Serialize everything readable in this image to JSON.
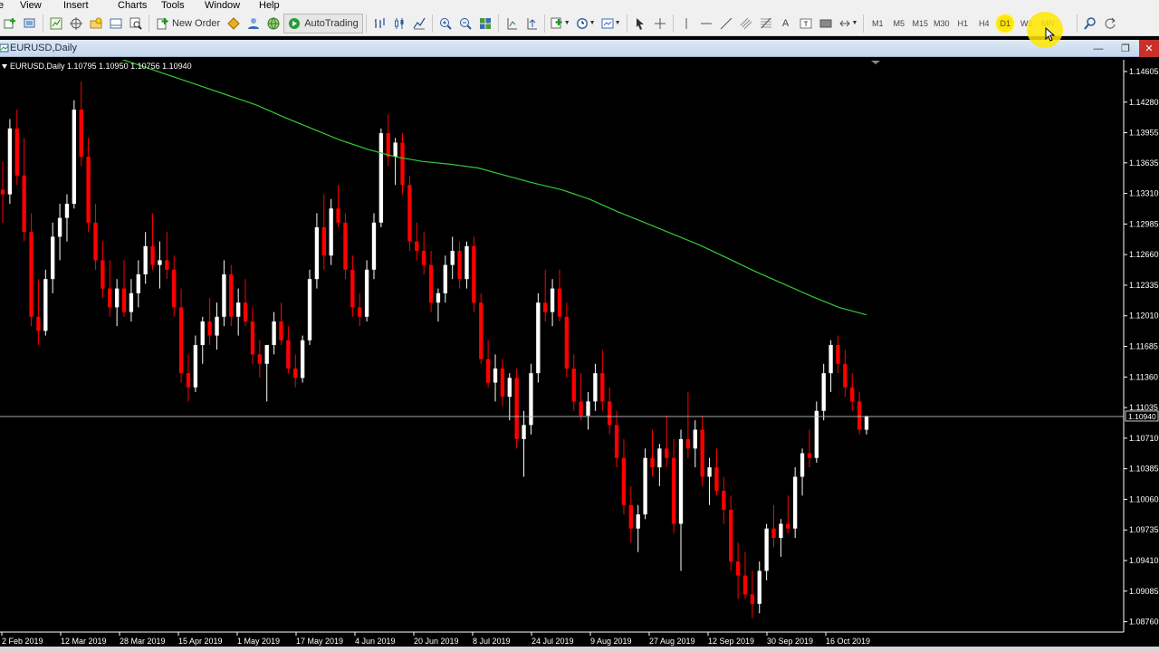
{
  "menu": {
    "items": [
      "e",
      "View",
      "Insert",
      "Charts",
      "Tools",
      "Window",
      "Help"
    ]
  },
  "toolbar": {
    "new_order_label": "New Order",
    "autotrading_label": "AutoTrading",
    "timeframes": [
      "M1",
      "M5",
      "M15",
      "M30",
      "H1",
      "H4",
      "D1",
      "W1",
      "MN"
    ],
    "active_timeframe": "D1"
  },
  "chart_window": {
    "title": "EURUSD,Daily"
  },
  "ohlc_label": "EURUSD,Daily  1.10795 1.10950 1.10756 1.10940",
  "colors": {
    "bull": "#ffffff",
    "bear": "#ff0000",
    "ma": "#33cc33",
    "background": "#000000",
    "price_line": "#c0c0c0"
  },
  "chart_data": {
    "type": "candlestick",
    "symbol": "EURUSD",
    "timeframe": "Daily",
    "y_ticks": [
      1.14605,
      1.1428,
      1.13955,
      1.13635,
      1.1331,
      1.12985,
      1.1266,
      1.12335,
      1.1201,
      1.11685,
      1.1136,
      1.11035,
      1.1071,
      1.10385,
      1.1006,
      1.09735,
      1.0941,
      1.09085,
      1.0876
    ],
    "x_ticks": [
      "2 Feb 2019",
      "12 Mar 2019",
      "28 Mar 2019",
      "15 Apr 2019",
      "1 May 2019",
      "17 May 2019",
      "4 Jun 2019",
      "20 Jun 2019",
      "8 Jul 2019",
      "24 Jul 2019",
      "9 Aug 2019",
      "27 Aug 2019",
      "12 Sep 2019",
      "30 Sep 2019",
      "16 Oct 2019"
    ],
    "current_price": 1.1094,
    "current_price_label": "1.10940",
    "ylim": [
      1.0865,
      1.1473
    ],
    "candles": [
      [
        1.1335,
        1.1365,
        1.13,
        1.133
      ],
      [
        1.133,
        1.141,
        1.132,
        1.14
      ],
      [
        1.14,
        1.142,
        1.134,
        1.135
      ],
      [
        1.135,
        1.139,
        1.128,
        1.129
      ],
      [
        1.129,
        1.131,
        1.119,
        1.12
      ],
      [
        1.12,
        1.124,
        1.117,
        1.1185
      ],
      [
        1.1185,
        1.125,
        1.118,
        1.124
      ],
      [
        1.124,
        1.13,
        1.1225,
        1.1285
      ],
      [
        1.1285,
        1.132,
        1.126,
        1.1305
      ],
      [
        1.1305,
        1.133,
        1.128,
        1.132
      ],
      [
        1.132,
        1.143,
        1.1315,
        1.142
      ],
      [
        1.142,
        1.145,
        1.136,
        1.137
      ],
      [
        1.137,
        1.139,
        1.129,
        1.13
      ],
      [
        1.13,
        1.132,
        1.125,
        1.126
      ],
      [
        1.126,
        1.128,
        1.122,
        1.123
      ],
      [
        1.123,
        1.126,
        1.12,
        1.121
      ],
      [
        1.121,
        1.124,
        1.119,
        1.123
      ],
      [
        1.123,
        1.126,
        1.12,
        1.1205
      ],
      [
        1.1205,
        1.124,
        1.1195,
        1.1225
      ],
      [
        1.1225,
        1.126,
        1.121,
        1.1245
      ],
      [
        1.1245,
        1.129,
        1.1235,
        1.1275
      ],
      [
        1.1275,
        1.131,
        1.125,
        1.1255
      ],
      [
        1.1255,
        1.128,
        1.123,
        1.126
      ],
      [
        1.126,
        1.129,
        1.124,
        1.125
      ],
      [
        1.125,
        1.1265,
        1.12,
        1.121
      ],
      [
        1.121,
        1.123,
        1.113,
        1.114
      ],
      [
        1.114,
        1.116,
        1.111,
        1.1125
      ],
      [
        1.1125,
        1.118,
        1.112,
        1.117
      ],
      [
        1.117,
        1.12,
        1.115,
        1.1195
      ],
      [
        1.1195,
        1.122,
        1.117,
        1.118
      ],
      [
        1.118,
        1.1215,
        1.1165,
        1.12
      ],
      [
        1.12,
        1.126,
        1.119,
        1.1245
      ],
      [
        1.1245,
        1.1255,
        1.119,
        1.12
      ],
      [
        1.12,
        1.123,
        1.118,
        1.1215
      ],
      [
        1.1215,
        1.124,
        1.119,
        1.1195
      ],
      [
        1.1195,
        1.121,
        1.115,
        1.116
      ],
      [
        1.116,
        1.1175,
        1.1135,
        1.115
      ],
      [
        1.115,
        1.117,
        1.111,
        1.117
      ],
      [
        1.117,
        1.1205,
        1.116,
        1.1195
      ],
      [
        1.1195,
        1.1215,
        1.117,
        1.1175
      ],
      [
        1.1175,
        1.119,
        1.114,
        1.1145
      ],
      [
        1.1145,
        1.116,
        1.1125,
        1.1135
      ],
      [
        1.1135,
        1.118,
        1.113,
        1.1175
      ],
      [
        1.1175,
        1.125,
        1.117,
        1.124
      ],
      [
        1.124,
        1.131,
        1.123,
        1.1295
      ],
      [
        1.1295,
        1.133,
        1.125,
        1.1265
      ],
      [
        1.1265,
        1.1325,
        1.1255,
        1.1315
      ],
      [
        1.1315,
        1.134,
        1.1295,
        1.13
      ],
      [
        1.13,
        1.131,
        1.124,
        1.125
      ],
      [
        1.125,
        1.1265,
        1.12,
        1.121
      ],
      [
        1.121,
        1.1225,
        1.119,
        1.12
      ],
      [
        1.12,
        1.126,
        1.1195,
        1.125
      ],
      [
        1.125,
        1.131,
        1.124,
        1.13
      ],
      [
        1.13,
        1.14,
        1.1295,
        1.1395
      ],
      [
        1.1395,
        1.1415,
        1.136,
        1.137
      ],
      [
        1.137,
        1.139,
        1.134,
        1.1385
      ],
      [
        1.1385,
        1.1395,
        1.133,
        1.134
      ],
      [
        1.134,
        1.135,
        1.127,
        1.128
      ],
      [
        1.128,
        1.13,
        1.126,
        1.127
      ],
      [
        1.127,
        1.129,
        1.1245,
        1.1255
      ],
      [
        1.1255,
        1.127,
        1.1205,
        1.1215
      ],
      [
        1.1215,
        1.123,
        1.1195,
        1.1225
      ],
      [
        1.1225,
        1.1265,
        1.1215,
        1.1255
      ],
      [
        1.1255,
        1.1285,
        1.124,
        1.127
      ],
      [
        1.127,
        1.128,
        1.123,
        1.124
      ],
      [
        1.124,
        1.128,
        1.123,
        1.1275
      ],
      [
        1.1275,
        1.1285,
        1.1205,
        1.1215
      ],
      [
        1.1215,
        1.1225,
        1.115,
        1.1155
      ],
      [
        1.1155,
        1.1175,
        1.1125,
        1.113
      ],
      [
        1.113,
        1.116,
        1.111,
        1.1145
      ],
      [
        1.1145,
        1.1155,
        1.1105,
        1.1115
      ],
      [
        1.1115,
        1.114,
        1.109,
        1.1135
      ],
      [
        1.1135,
        1.1145,
        1.106,
        1.107
      ],
      [
        1.107,
        1.11,
        1.103,
        1.1085
      ],
      [
        1.1085,
        1.115,
        1.1075,
        1.114
      ],
      [
        1.114,
        1.1225,
        1.113,
        1.1215
      ],
      [
        1.1215,
        1.125,
        1.1195,
        1.1205
      ],
      [
        1.1205,
        1.124,
        1.119,
        1.123
      ],
      [
        1.123,
        1.125,
        1.1195,
        1.12
      ],
      [
        1.12,
        1.1215,
        1.1135,
        1.1145
      ],
      [
        1.1145,
        1.116,
        1.11,
        1.111
      ],
      [
        1.111,
        1.114,
        1.109,
        1.1095
      ],
      [
        1.1095,
        1.112,
        1.108,
        1.111
      ],
      [
        1.111,
        1.115,
        1.11,
        1.114
      ],
      [
        1.114,
        1.1165,
        1.11,
        1.111
      ],
      [
        1.111,
        1.1125,
        1.1075,
        1.1085
      ],
      [
        1.1085,
        1.11,
        1.104,
        1.105
      ],
      [
        1.105,
        1.107,
        1.099,
        1.1
      ],
      [
        1.1,
        1.102,
        1.096,
        1.0975
      ],
      [
        1.0975,
        1.1,
        1.095,
        1.099
      ],
      [
        1.099,
        1.106,
        1.0985,
        1.105
      ],
      [
        1.105,
        1.108,
        1.103,
        1.104
      ],
      [
        1.104,
        1.1065,
        1.102,
        1.106
      ],
      [
        1.106,
        1.1095,
        1.104,
        1.105
      ],
      [
        1.105,
        1.107,
        1.097,
        1.098
      ],
      [
        1.098,
        1.108,
        1.093,
        1.107
      ],
      [
        1.107,
        1.112,
        1.105,
        1.106
      ],
      [
        1.106,
        1.109,
        1.104,
        1.108
      ],
      [
        1.108,
        1.1095,
        1.102,
        1.103
      ],
      [
        1.103,
        1.105,
        1.1,
        1.104
      ],
      [
        1.104,
        1.106,
        1.101,
        1.1015
      ],
      [
        1.1015,
        1.103,
        1.098,
        1.0995
      ],
      [
        1.0995,
        1.101,
        1.093,
        1.094
      ],
      [
        1.094,
        1.096,
        1.09,
        1.0925
      ],
      [
        1.0925,
        1.095,
        1.09,
        1.0905
      ],
      [
        1.0905,
        1.093,
        1.088,
        1.0895
      ],
      [
        1.0895,
        1.094,
        1.0885,
        1.093
      ],
      [
        1.093,
        1.098,
        1.092,
        1.0975
      ],
      [
        1.0975,
        1.1,
        1.0955,
        1.0965
      ],
      [
        1.0965,
        1.0985,
        1.0945,
        1.098
      ],
      [
        1.098,
        1.101,
        1.097,
        1.0975
      ],
      [
        1.0975,
        1.104,
        1.0965,
        1.103
      ],
      [
        1.103,
        1.106,
        1.101,
        1.1055
      ],
      [
        1.1055,
        1.108,
        1.104,
        1.105
      ],
      [
        1.105,
        1.111,
        1.1045,
        1.11
      ],
      [
        1.11,
        1.115,
        1.109,
        1.114
      ],
      [
        1.114,
        1.1175,
        1.112,
        1.117
      ],
      [
        1.117,
        1.118,
        1.114,
        1.115
      ],
      [
        1.115,
        1.1165,
        1.1115,
        1.1125
      ],
      [
        1.1125,
        1.114,
        1.11,
        1.111
      ],
      [
        1.111,
        1.112,
        1.1075,
        1.108
      ],
      [
        1.108,
        1.1095,
        1.1075,
        1.1094
      ]
    ],
    "ma": [
      1.1475,
      1.1465,
      1.1455,
      1.1445,
      1.1435,
      1.1425,
      1.1412,
      1.14,
      1.1388,
      1.1378,
      1.137,
      1.1365,
      1.1362,
      1.1358,
      1.135,
      1.1342,
      1.1335,
      1.1325,
      1.1312,
      1.13,
      1.1288,
      1.1276,
      1.1262,
      1.1248,
      1.1235,
      1.1222,
      1.121,
      1.1202
    ]
  }
}
